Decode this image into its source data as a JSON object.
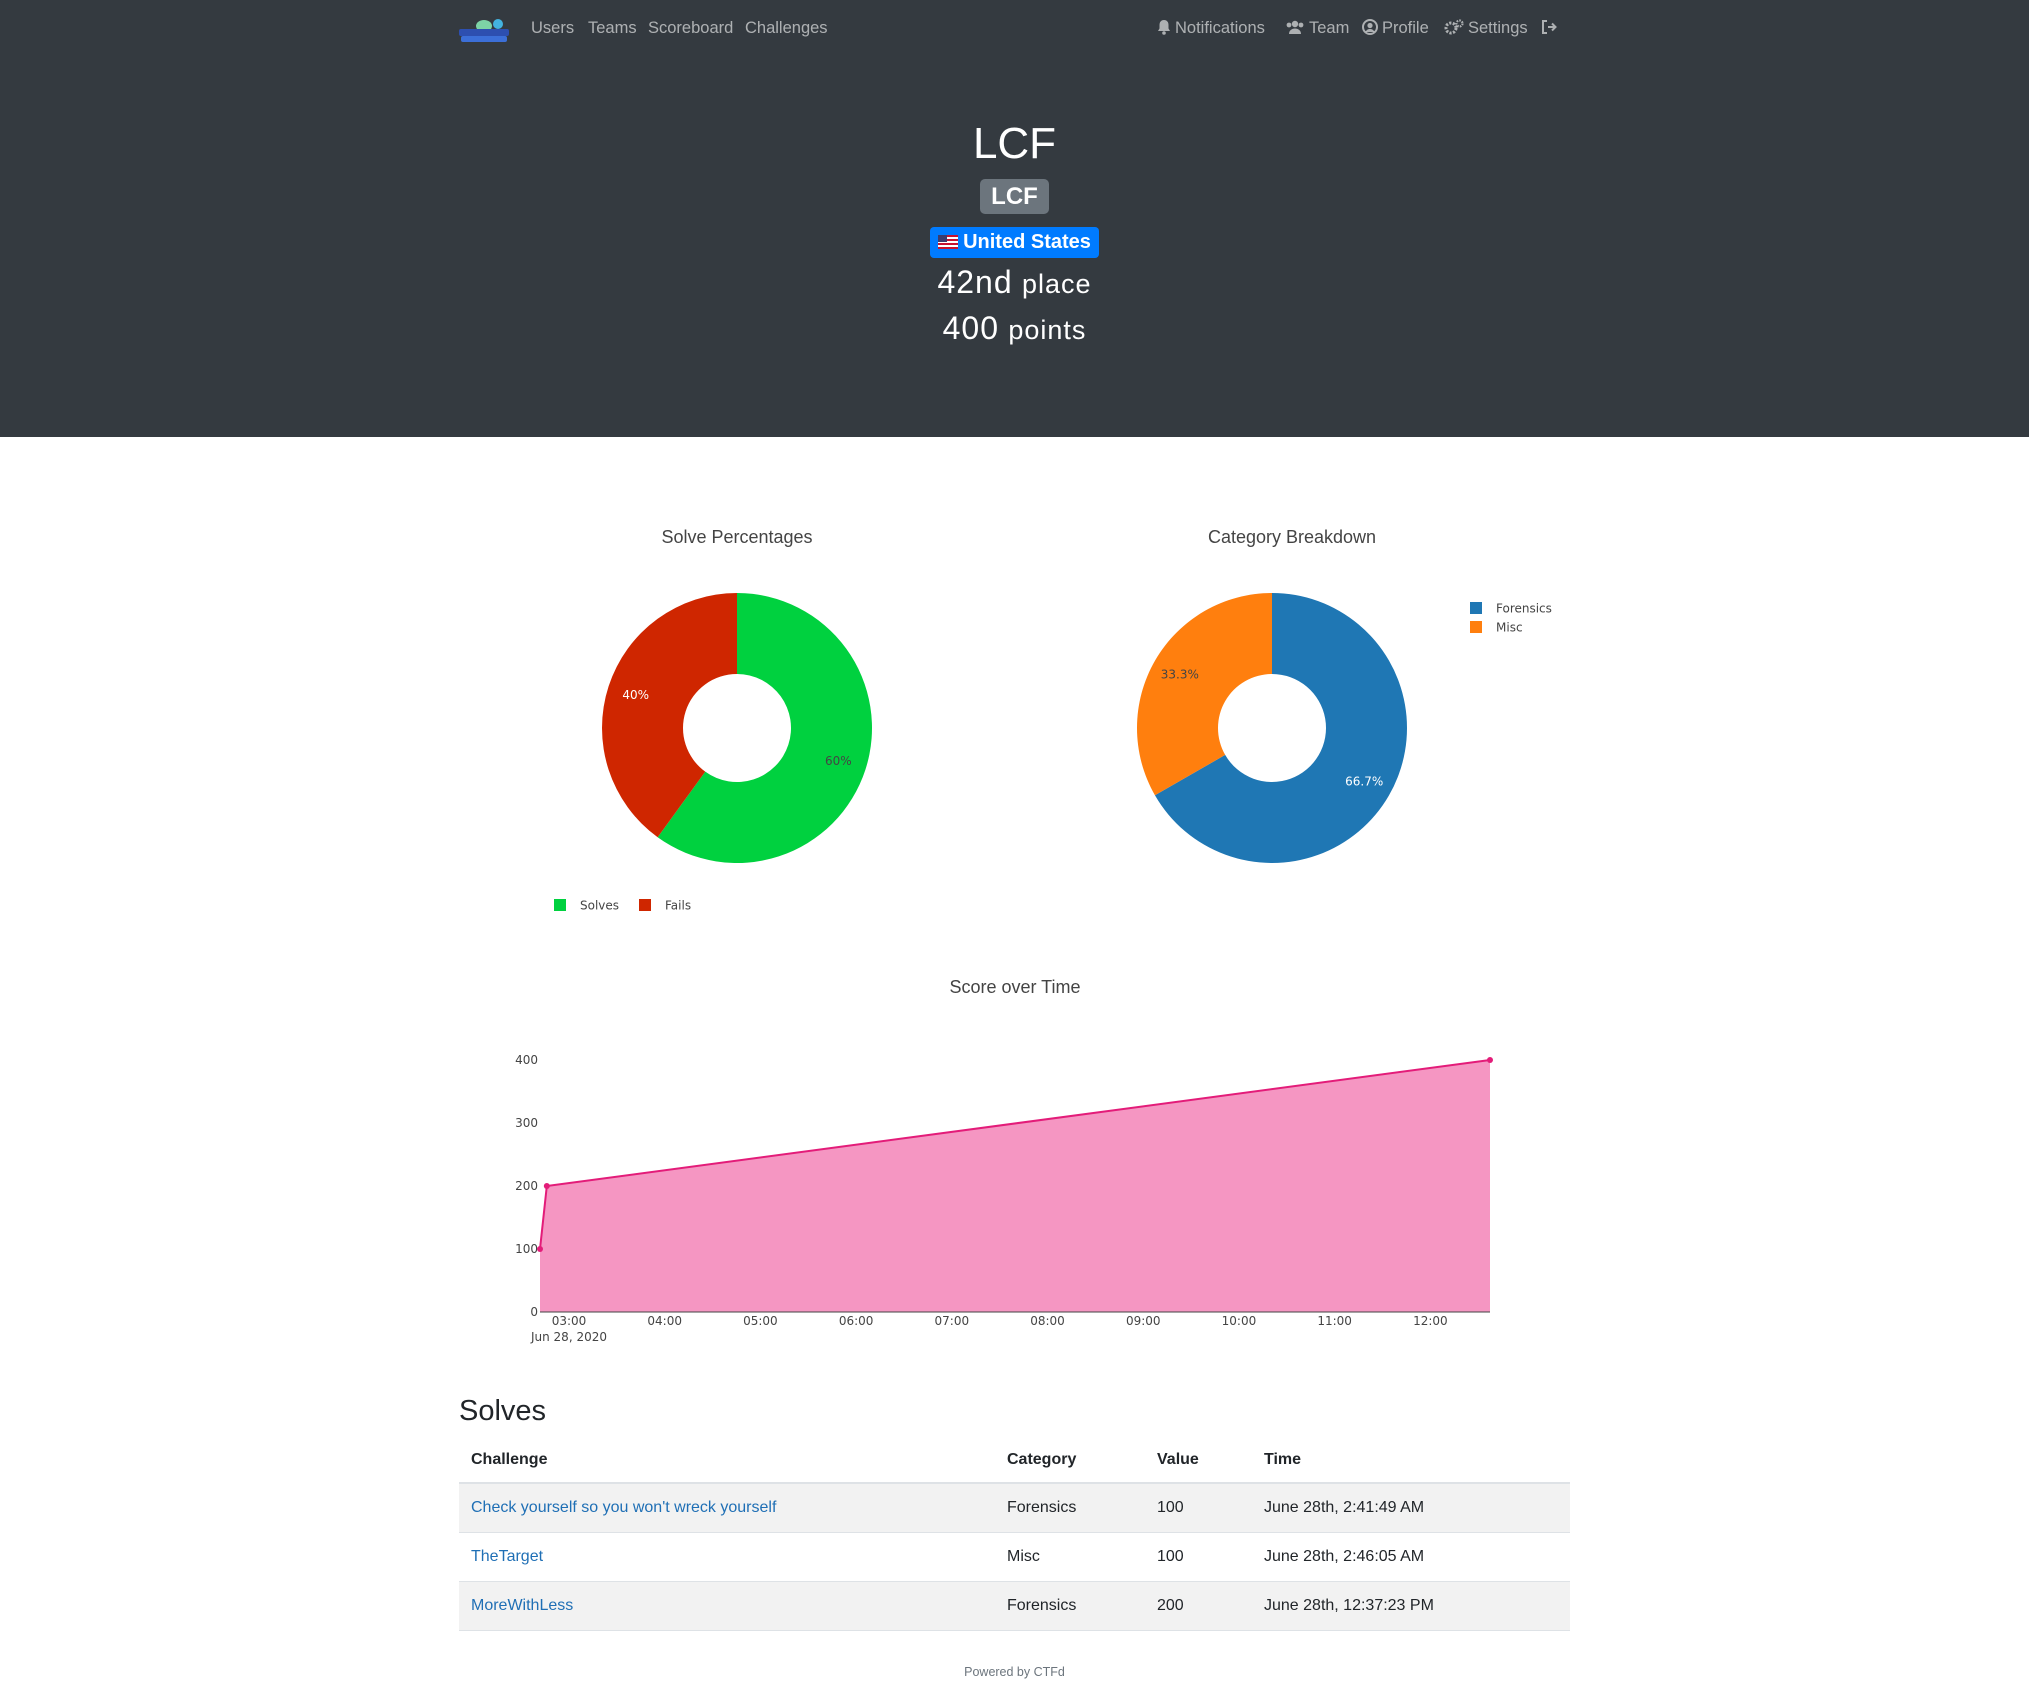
{
  "navbar": {
    "left_links": [
      "Users",
      "Teams",
      "Scoreboard",
      "Challenges"
    ],
    "right_links": [
      "Notifications",
      "Team",
      "Profile",
      "Settings"
    ]
  },
  "team": {
    "name": "LCF",
    "affiliation": "LCF",
    "country": "United States",
    "place_number": "42nd",
    "place_word": "place",
    "points_number": "400",
    "points_word": "points"
  },
  "charts": {
    "solve_title": "Solve Percentages",
    "category_title": "Category Breakdown",
    "score_title": "Score over Time"
  },
  "chart_data": [
    {
      "type": "pie",
      "title": "Solve Percentages",
      "labels": [
        "Solves",
        "Fails"
      ],
      "values": [
        60,
        40
      ],
      "text_labels": [
        "60%",
        "40%"
      ],
      "colors": [
        "#00d13f",
        "#cf2600"
      ],
      "legend": "bottom"
    },
    {
      "type": "pie",
      "title": "Category Breakdown",
      "labels": [
        "Forensics",
        "Misc"
      ],
      "values": [
        66.7,
        33.3
      ],
      "text_labels": [
        "66.7%",
        "33.3%"
      ],
      "colors": [
        "#1f77b4",
        "#ff7f0e"
      ],
      "legend": "top-right"
    },
    {
      "type": "area",
      "title": "Score over Time",
      "x": [
        "2020-06-28 02:41:49",
        "2020-06-28 02:46:05",
        "2020-06-28 12:37:23"
      ],
      "y": [
        100,
        200,
        400
      ],
      "ylim": [
        0,
        400
      ],
      "yticks": [
        "0",
        "100",
        "200",
        "300",
        "400"
      ],
      "xticks": [
        "03:00",
        "04:00",
        "05:00",
        "06:00",
        "07:00",
        "08:00",
        "09:00",
        "10:00",
        "11:00",
        "12:00"
      ],
      "x_date_label": "Jun 28, 2020",
      "color": "#e31c79",
      "fill": "#f596c2"
    }
  ],
  "solves": {
    "title": "Solves",
    "headers": [
      "Challenge",
      "Category",
      "Value",
      "Time"
    ],
    "rows": [
      [
        "Check yourself so you won't wreck yourself",
        "Forensics",
        "100",
        "June 28th, 2:41:49 AM"
      ],
      [
        "TheTarget",
        "Misc",
        "100",
        "June 28th, 2:46:05 AM"
      ],
      [
        "MoreWithLess",
        "Forensics",
        "200",
        "June 28th, 12:37:23 PM"
      ]
    ]
  },
  "footer": "Powered by CTFd"
}
